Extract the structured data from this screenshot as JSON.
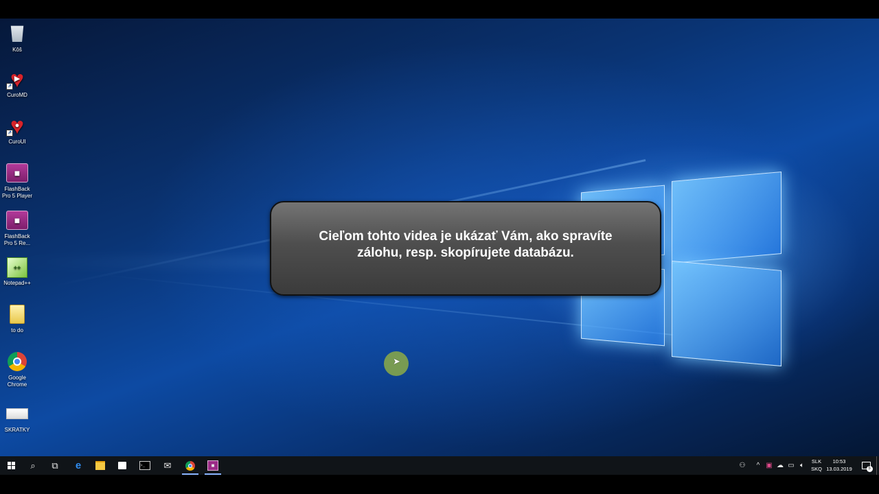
{
  "desktop_icons": [
    {
      "label": "Kôš",
      "icon": "recycle-bin-icon"
    },
    {
      "label": "CuroMD",
      "icon": "curomd-icon"
    },
    {
      "label": "CuroUI",
      "icon": "curoui-icon"
    },
    {
      "label": "FlashBack Pro 5 Player",
      "icon": "flashback-player-icon"
    },
    {
      "label": "FlashBack Pro 5 Re...",
      "icon": "flashback-recorder-icon"
    },
    {
      "label": "Notepad++",
      "icon": "notepad-plus-plus-icon"
    },
    {
      "label": "to do",
      "icon": "text-file-icon"
    },
    {
      "label": "Google Chrome",
      "icon": "chrome-icon"
    },
    {
      "label": "SKRATKY",
      "icon": "shortcuts-file-icon"
    }
  ],
  "callout": {
    "text": "Cieľom tohto videa je ukázať Vám, ako spravíte zálohu, resp. skopírujete databázu."
  },
  "taskbar": {
    "pinned": [
      {
        "icon": "start-icon"
      },
      {
        "icon": "search-icon"
      },
      {
        "icon": "task-view-icon"
      },
      {
        "icon": "edge-icon"
      },
      {
        "icon": "file-explorer-icon"
      },
      {
        "icon": "store-icon"
      },
      {
        "icon": "command-prompt-icon"
      },
      {
        "icon": "mail-icon"
      },
      {
        "icon": "chrome-icon"
      },
      {
        "icon": "flashback-icon"
      }
    ],
    "language_line1": "SLK",
    "language_line2": "SKQ",
    "time": "10:53",
    "date": "13.03.2019",
    "notification_count": "5"
  },
  "colors": {
    "callout_bg": "#4e4e4e",
    "taskbar_bg": "#101418",
    "desktop_accent": "#0d4aa3",
    "cursor_highlight": "#8caa46"
  }
}
